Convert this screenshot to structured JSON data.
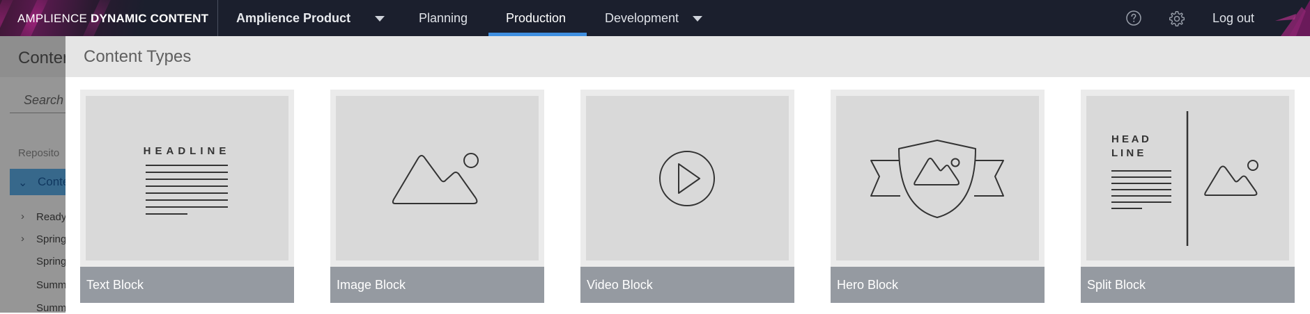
{
  "brand": {
    "light": "AMPLIENCE",
    "bold": "DYNAMIC CONTENT"
  },
  "topnav": {
    "hub": "Amplience Product",
    "items": [
      "Planning",
      "Production",
      "Development"
    ],
    "active": "Production",
    "logout": "Log out",
    "icons": [
      "help-icon",
      "gear-icon"
    ]
  },
  "background": {
    "title": "Conten",
    "search_placeholder": "Search",
    "section_label": "Reposito",
    "selected_item": "Conte",
    "rows": [
      "Ready",
      "Spring",
      "Spring",
      "Summ",
      "Summ"
    ]
  },
  "modal": {
    "title": "Content Types",
    "cards": [
      {
        "label": "Text Block",
        "preview_headline": "HEADLINE"
      },
      {
        "label": "Image Block"
      },
      {
        "label": "Video Block"
      },
      {
        "label": "Hero Block"
      },
      {
        "label": "Split Block",
        "preview_headline_1": "H E A D",
        "preview_headline_2": "L I N E"
      }
    ]
  },
  "colors": {
    "topbar": "#1b1f2d",
    "active_underline": "#3f8fe0",
    "card_label_bg": "#959aa1",
    "preview_bg": "#d9d9d9"
  }
}
